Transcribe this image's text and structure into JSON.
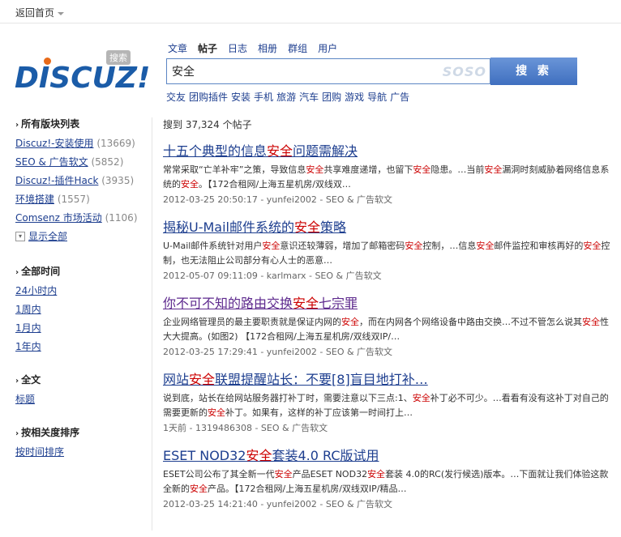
{
  "topbar": {
    "home": "返回首页"
  },
  "logo": {
    "text": "DISCUZ!",
    "badge": "搜索"
  },
  "search": {
    "tabs": [
      "文章",
      "帖子",
      "日志",
      "相册",
      "群组",
      "用户"
    ],
    "active_tab": "帖子",
    "query": "安全",
    "provider": "SOSO",
    "button": "搜 索",
    "hotwords": [
      "交友",
      "团购插件",
      "安装",
      "手机",
      "旅游",
      "汽车",
      "团购",
      "游戏",
      "导航",
      "广告"
    ]
  },
  "sidebar": {
    "forums_title": "所有版块列表",
    "forums": [
      {
        "name": "Discuz!-安装使用",
        "count": "(13669)"
      },
      {
        "name": "SEO & 广告软文",
        "count": "(5852)"
      },
      {
        "name": "Discuz!-插件Hack",
        "count": "(3935)"
      },
      {
        "name": "环境搭建",
        "count": "(1557)"
      },
      {
        "name": "Comsenz 市场活动",
        "count": "(1106)"
      }
    ],
    "show_all": "显示全部",
    "time_title": "全部时间",
    "time_options": [
      "24小时内",
      "1周内",
      "1月内",
      "1年内"
    ],
    "scope_title": "全文",
    "scope_options": [
      "标题"
    ],
    "sort_title": "按相关度排序",
    "sort_options": [
      "按时间排序"
    ]
  },
  "results": {
    "count_text": "搜到 37,324 个帖子",
    "items": [
      {
        "title": "十五个典型的信息<em class=\"hl\">安全</em>问题需解决",
        "snippet": "常常采取“亡羊补牢”之策，导致信息<em class=\"hl\">安全</em>共享难度递增，也留下<em class=\"hl\">安全</em>隐患。…当前<em class=\"hl\">安全</em>漏洞时刻威胁着网络信息系统的<em class=\"hl\">安全</em>。【172合租网/上海五星机房/双线双…",
        "meta": "2012-03-25 20:50:17 - yunfei2002 - SEO & 广告软文",
        "visited": false
      },
      {
        "title": "揭秘U-Mail邮件系统的<em class=\"hl\">安全</em>策略",
        "snippet": "U-Mail邮件系统针对用户<em class=\"hl\">安全</em>意识还较薄弱，增加了邮箱密码<em class=\"hl\">安全</em>控制，…信息<em class=\"hl\">安全</em>邮件监控和审核再好的<em class=\"hl\">安全</em>控制，也无法阻止公司部分有心人士的恶意…",
        "meta": "2012-05-07 09:11:09 - karlmarx - SEO & 广告软文",
        "visited": false
      },
      {
        "title": "你不可不知的路由交换<em class=\"hl\">安全</em>七宗罪",
        "snippet": "企业网络管理员的最主要职责就是保证内网的<em class=\"hl\">安全</em>，而在内网各个网络设备中路由交换…不过不管怎么说其<em class=\"hl\">安全</em>性大大提高。(如图2) 【172合租网/上海五星机房/双线双IP/…",
        "meta": "2012-03-25 17:29:41 - yunfei2002 - SEO & 广告软文",
        "visited": true
      },
      {
        "title": "网站<em class=\"hl\">安全</em>联盟提醒站长：不要[8]盲目地打补…",
        "snippet": "说到底，站长在给网站服务器打补丁时，需要注意以下三点:1、<em class=\"hl\">安全</em>补丁必不可少。…看看有没有这补丁对自己的需要更新的<em class=\"hl\">安全</em>补丁。如果有，这样的补丁应该第一时间打上…",
        "meta": "1天前 - 1319486308 - SEO & 广告软文",
        "visited": false
      },
      {
        "title": "ESET NOD32<em class=\"hl\">安全</em>套装4.0 RC版试用",
        "snippet": "ESET公司公布了其全新一代<em class=\"hl\">安全</em>产品ESET NOD32<em class=\"hl\">安全</em>套装 4.0的RC(发行候选)版本。…下面就让我们体验这款全新的<em class=\"hl\">安全</em>产品。【172合租网/上海五星机房/双线双IP/精品…",
        "meta": "2012-03-25 14:21:40 - yunfei2002 - SEO & 广告软文",
        "visited": false
      }
    ]
  }
}
